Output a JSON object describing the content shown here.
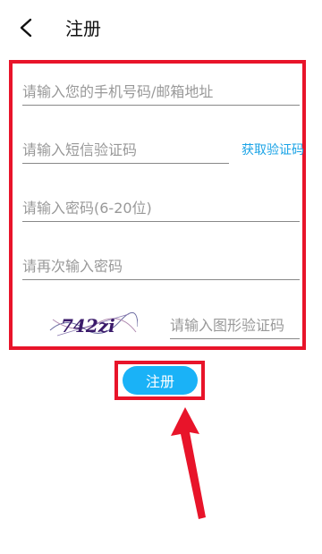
{
  "header": {
    "title": "注册"
  },
  "form": {
    "account_placeholder": "请输入您的手机号码/邮箱地址",
    "sms_code_placeholder": "请输入短信验证码",
    "get_code_label": "获取验证码",
    "password_placeholder": "请输入密码(6-20位)",
    "confirm_password_placeholder": "请再次输入密码",
    "captcha_text": "742zi",
    "captcha_input_placeholder": "请输入图形验证码",
    "submit_label": "注册"
  },
  "colors": {
    "accent": "#1ab2f7",
    "annotation": "#e8142a",
    "link": "#1aa3e6"
  },
  "icons": {
    "back": "chevron-left-icon"
  }
}
